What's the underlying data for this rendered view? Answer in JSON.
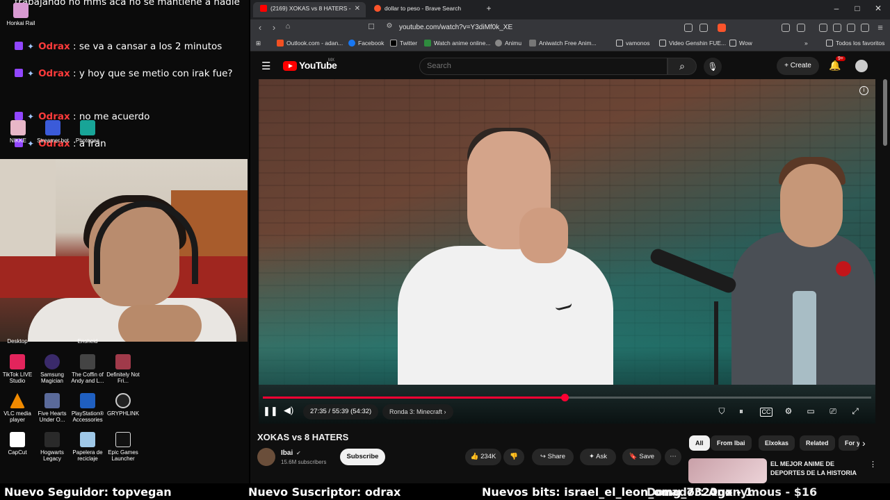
{
  "chat": {
    "partial_line": "trabajando no mms acá no se mantiene a nadie",
    "lines": [
      {
        "user": "Odrax",
        "text": " : se va a cansar a los 2 minutos"
      },
      {
        "user": "Odrax",
        "text": " : y hoy que se metio con irak fue?"
      },
      {
        "user": "Odrax",
        "text": " : no me acuerdo"
      },
      {
        "user": "Odrax",
        "text": " : a Iran"
      }
    ]
  },
  "desktop": {
    "top_icons": [
      "Honkai Rail",
      "NIKKE",
      "Streamer.bot",
      "Photopea"
    ],
    "partial_labels": [
      "Desktop",
      "Ensheid"
    ],
    "row1": [
      "TikTok LIVE Studio",
      "Samsung Magician",
      "The Coffin of Andy and L...",
      "Definitely Not Fri..."
    ],
    "row2": [
      "VLC media player",
      "Five Hearts Under O...",
      "PlayStation® Accessories",
      "GRYPHLINK"
    ],
    "row3": [
      "CapCut",
      "Hogwarts Legacy",
      "Papelera de reciclaje",
      "Epic Games Launcher"
    ]
  },
  "browser": {
    "tabs": [
      {
        "label": "(2169) XOKAS vs 8 HATERS -",
        "active": true,
        "color": "#ff0000"
      },
      {
        "label": "dollar to peso - Brave Search",
        "active": false,
        "color": "#fb542b"
      }
    ],
    "url": "youtube.com/watch?v=Y3diMf0k_XE",
    "bookmarks": [
      "Outlook.com - adan...",
      "Facebook",
      "Twitter",
      "Watch anime online...",
      "Animu",
      "Aniwatch Free Anim...",
      "vamonos",
      "Video Genshin FUE...",
      "Wow"
    ],
    "all_bookmarks": "Todos los favoritos"
  },
  "youtube": {
    "logo": "YouTube",
    "region": "MX",
    "search_placeholder": "Search",
    "create_label": "Create",
    "notif_count": "9+",
    "player": {
      "time": "27:35 / 55:39 (54:32)",
      "chapter": "Ronda 3: Minecraft",
      "progress_fraction": 0.496
    },
    "video": {
      "title": "XOKAS vs 8 HATERS",
      "channel": "Ibai",
      "subscribers": "15.6M subscribers",
      "subscribe": "Subscribe",
      "likes": "234K",
      "share": "Share",
      "ask": "Ask",
      "save": "Save"
    },
    "chips": [
      "All",
      "From Ibai",
      "Elxokas",
      "Related",
      "For yo"
    ],
    "recommended_title": "EL MEJOR ANIME DE DEPORTES DE LA HISTORIA"
  },
  "ticker": {
    "follower": "Nuevo Seguidor: topvegan",
    "subscriber": "Nuevo Suscriptor: odrax",
    "bits": "Nuevos bits: israel_el_leon_omg_7320gx - 1",
    "donor": "Donador: Anonymous - $16"
  },
  "colors": {
    "accent_red": "#ff0033",
    "twitch_purple": "#9146ff",
    "chat_user": "#ff3b3b"
  }
}
